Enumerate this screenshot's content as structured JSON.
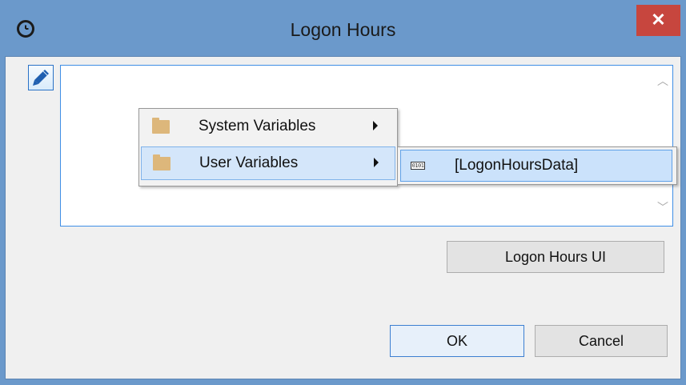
{
  "window": {
    "title": "Logon Hours",
    "close_label": "✕",
    "title_icon": "clock-icon"
  },
  "editor": {
    "edit_icon": "pencil-icon",
    "scroll_up": "︿",
    "scroll_down": "﹀"
  },
  "context_menu": {
    "items": [
      {
        "label": "System Variables",
        "icon": "folder-icon",
        "has_submenu": true
      },
      {
        "label": "User Variables",
        "icon": "folder-icon",
        "has_submenu": true,
        "highlighted": true
      }
    ]
  },
  "submenu": {
    "items": [
      {
        "label": "[LogonHoursData]",
        "icon": "variable-icon",
        "highlighted": true
      }
    ],
    "icon_text": "0101"
  },
  "buttons": {
    "logon_hours_ui": "Logon Hours UI",
    "ok": "OK",
    "cancel": "Cancel"
  },
  "colors": {
    "title_bar": "#6b99cb",
    "close_button": "#c7463e",
    "highlight": "#cbe2fb"
  }
}
